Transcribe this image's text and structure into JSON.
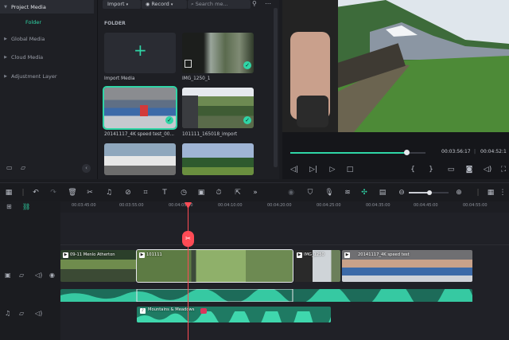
{
  "sidebar": {
    "title": "Project Media",
    "folder": "Folder",
    "items": [
      {
        "label": "Global Media"
      },
      {
        "label": "Cloud Media"
      },
      {
        "label": "Adjustment Layer"
      }
    ]
  },
  "media": {
    "import_label": "Import",
    "record_label": "Record",
    "search_placeholder": "Search me...",
    "folder_heading": "FOLDER",
    "import_media_label": "Import Media",
    "clips": [
      {
        "name": "IMG_1250_1"
      },
      {
        "name": "20141117_4K speed test_00..."
      },
      {
        "name": "101111_165018_import"
      }
    ]
  },
  "player": {
    "current_time": "00:03:56:17",
    "total_time": "00:04:52:1",
    "progress": 0.86
  },
  "ruler": {
    "ticks": [
      "00:03:45:00",
      "00:03:55:00",
      "00:04:05:00",
      "00:04:10:00",
      "00:04:20:00",
      "00:04:25:00",
      "00:04:35:00",
      "00:04:45:00",
      "00:04:55:00"
    ]
  },
  "timeline": {
    "video_clips": [
      {
        "title": "09-11 Menlo Atherton"
      },
      {
        "title": "101111"
      },
      {
        "title": "IMG_1250"
      },
      {
        "title": "20141117_4K speed test"
      }
    ],
    "audio_clip": "Mountains & Meadows"
  },
  "colors": {
    "accent": "#2fd5a6",
    "playhead": "#ff4b55"
  }
}
